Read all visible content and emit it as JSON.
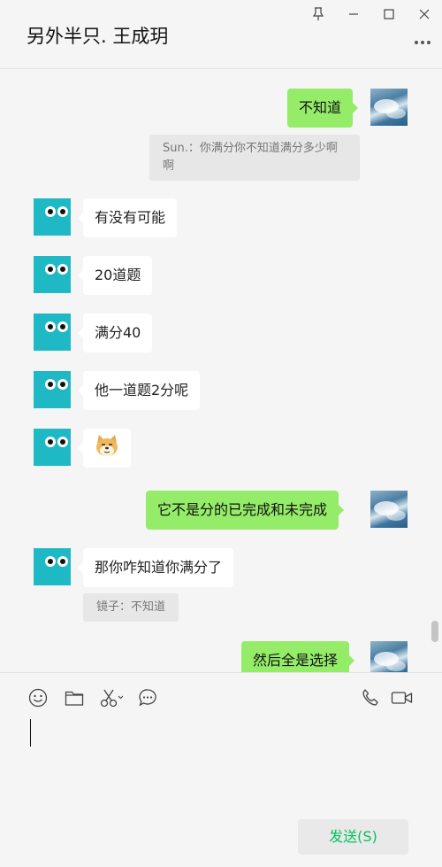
{
  "window": {
    "title": "另外半只. 王成玥"
  },
  "messages": [
    {
      "side": "out",
      "text": "不知道"
    },
    {
      "side": "quote",
      "text": "Sun.：你满分你不知道满分多少啊啊"
    },
    {
      "side": "in",
      "text": "有没有可能"
    },
    {
      "side": "in",
      "text": "20道题"
    },
    {
      "side": "in",
      "text": "满分40"
    },
    {
      "side": "in",
      "text": "他一道题2分呢"
    },
    {
      "side": "in",
      "emoji": "dog-emoji"
    },
    {
      "side": "out",
      "text": "它不是分的已完成和未完成"
    },
    {
      "side": "in",
      "text": "那你咋知道你满分了"
    },
    {
      "side": "quote",
      "text": "镜子：不知道"
    },
    {
      "side": "out",
      "text": "然后全是选择"
    }
  ],
  "toolbar": {
    "icons": [
      "emoji-icon",
      "folder-icon",
      "scissors-icon",
      "chat-bubble-icon",
      "phone-icon",
      "video-icon"
    ]
  },
  "composer": {
    "send_label": "发送(S)"
  },
  "colors": {
    "outgoing_bubble": "#95ec69",
    "incoming_bubble": "#ffffff",
    "send_text": "#07c160",
    "bot_avatar": "#1fb9c6"
  }
}
